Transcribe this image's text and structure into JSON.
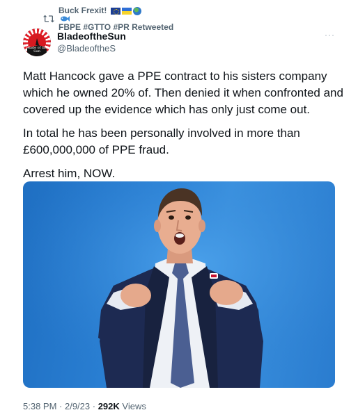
{
  "retweet": {
    "icon": "retweet-icon",
    "user_name": "Buck Frexit!",
    "suffix": "FBPE #GTTO #PR Retweeted"
  },
  "author": {
    "display_name": "BladeoftheSun",
    "handle": "@BladeoftheS",
    "avatar_text": "Blade of the Sun"
  },
  "tweet": {
    "paragraphs": [
      "Matt Hancock gave a PPE contract to his sisters company which he owned 20% of. Then denied it when confronted and covered up the evidence which has only just come out.",
      "In total he has been personally involved in more than £600,000,000 of PPE fraud.",
      "Arrest him, NOW."
    ]
  },
  "media": {
    "background": "#2d84d8"
  },
  "meta": {
    "time": "5:38 PM",
    "separator1": " · ",
    "date": "2/9/23",
    "separator2": " · ",
    "views_count": "292K",
    "views_label": " Views"
  },
  "colors": {
    "text": "#0f1419",
    "secondary": "#536471"
  }
}
